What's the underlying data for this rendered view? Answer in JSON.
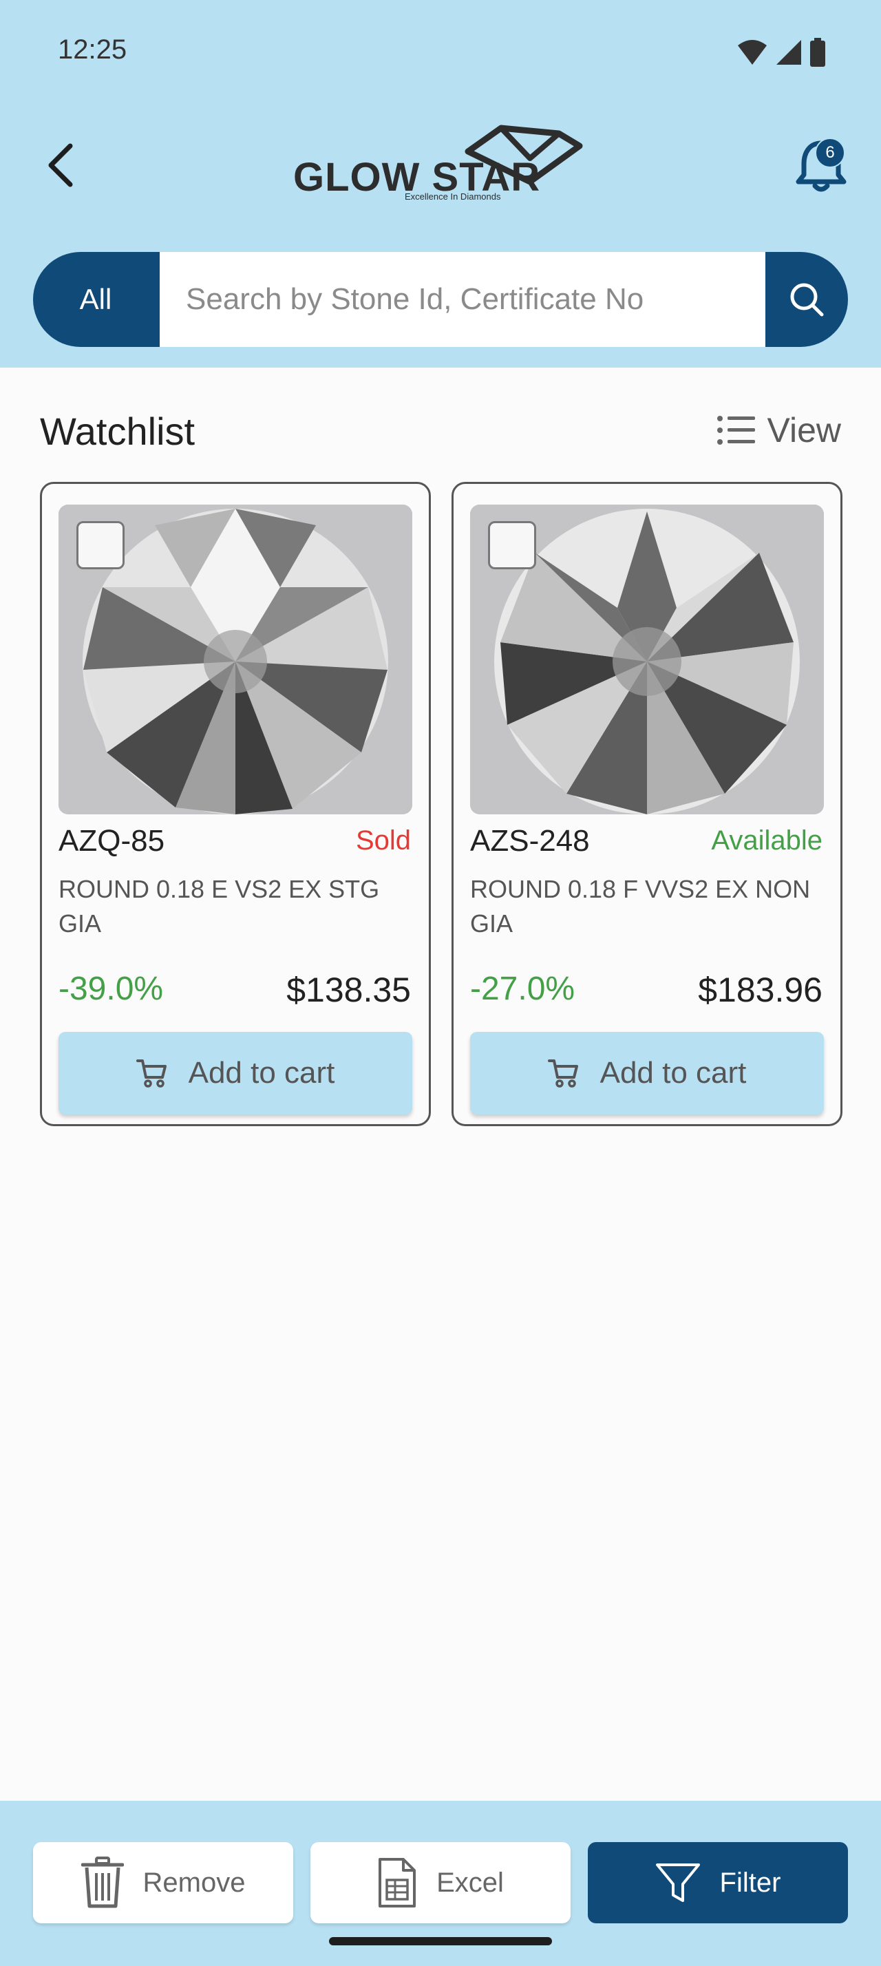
{
  "status_bar": {
    "time": "12:25"
  },
  "header": {
    "logo_name": "GLOW STAR",
    "logo_tagline": "Excellence In Diamonds",
    "notification_count": "6"
  },
  "search": {
    "scope": "All",
    "placeholder": "Search by Stone Id, Certificate No"
  },
  "watchlist": {
    "title": "Watchlist",
    "view_label": "View",
    "items": [
      {
        "stone_id": "AZQ-85",
        "status": "Sold",
        "status_color": "#e53935",
        "description": "ROUND 0.18 E VS2 EX STG GIA",
        "discount": "-39.0%",
        "price": "$138.35",
        "cart_label": "Add to cart"
      },
      {
        "stone_id": "AZS-248",
        "status": "Available",
        "status_color": "#43a047",
        "description": "ROUND 0.18 F VVS2 EX NON GIA",
        "discount": "-27.0%",
        "price": "$183.96",
        "cart_label": "Add to cart"
      }
    ]
  },
  "bottom_actions": {
    "remove": "Remove",
    "excel": "Excel",
    "filter": "Filter"
  },
  "colors": {
    "brand": "#0f4a78",
    "header_bg": "#b7e0f2"
  }
}
